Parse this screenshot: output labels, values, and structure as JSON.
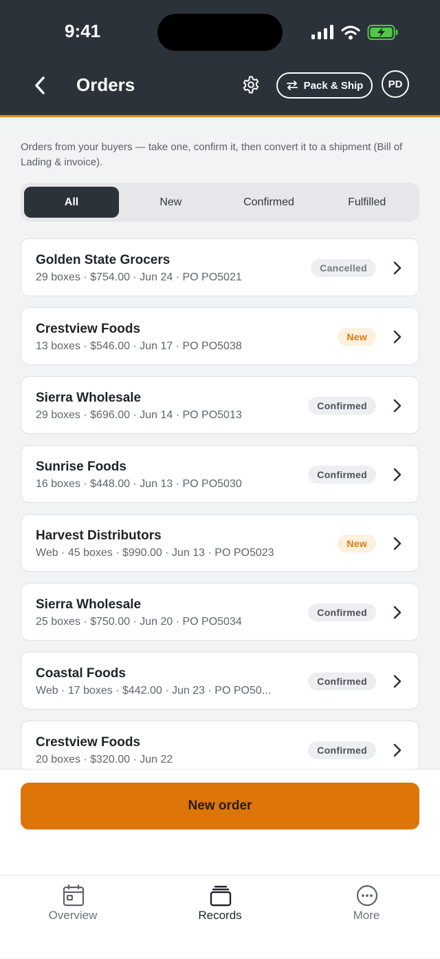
{
  "status_bar": {
    "time": "9:41"
  },
  "header": {
    "title": "Orders",
    "pack_ship_label": "Pack & Ship",
    "avatar_initials": "PD"
  },
  "description": "Orders from your buyers — take one, confirm it, then convert it to a shipment (Bill of Lading & invoice).",
  "tabs": [
    {
      "label": "All",
      "active": true
    },
    {
      "label": "New",
      "active": false
    },
    {
      "label": "Confirmed",
      "active": false
    },
    {
      "label": "Fulfilled",
      "active": false
    }
  ],
  "orders": [
    {
      "name": "Golden State Grocers",
      "meta": "29 boxes · $754.00 · Jun 24 · PO PO5021",
      "status": "Cancelled"
    },
    {
      "name": "Crestview Foods",
      "meta": "13 boxes · $546.00 · Jun 17 · PO PO5038",
      "status": "New"
    },
    {
      "name": "Sierra Wholesale",
      "meta": "29 boxes · $696.00 · Jun 14 · PO PO5013",
      "status": "Confirmed"
    },
    {
      "name": "Sunrise Foods",
      "meta": "16 boxes · $448.00 · Jun 13 · PO PO5030",
      "status": "Confirmed"
    },
    {
      "name": "Harvest Distributors",
      "meta": "Web · 45 boxes · $990.00 · Jun 13 · PO PO5023",
      "status": "New"
    },
    {
      "name": "Sierra Wholesale",
      "meta": "25 boxes · $750.00 · Jun 20 · PO PO5034",
      "status": "Confirmed"
    },
    {
      "name": "Coastal Foods",
      "meta": "Web · 17 boxes · $442.00 · Jun 23 · PO PO50...",
      "status": "Confirmed"
    },
    {
      "name": "Crestview Foods",
      "meta": "20 boxes · $320.00 · Jun 22",
      "status": "Confirmed"
    }
  ],
  "primary_action": {
    "label": "New order"
  },
  "bottom_nav": [
    {
      "label": "Overview",
      "icon": "calendar-icon",
      "active": false
    },
    {
      "label": "Records",
      "icon": "stack-icon",
      "active": true
    },
    {
      "label": "More",
      "icon": "more-icon",
      "active": false
    }
  ],
  "colors": {
    "header_bg": "#2b323a",
    "accent": "#dd7508",
    "new_badge": "#dd7a12"
  }
}
